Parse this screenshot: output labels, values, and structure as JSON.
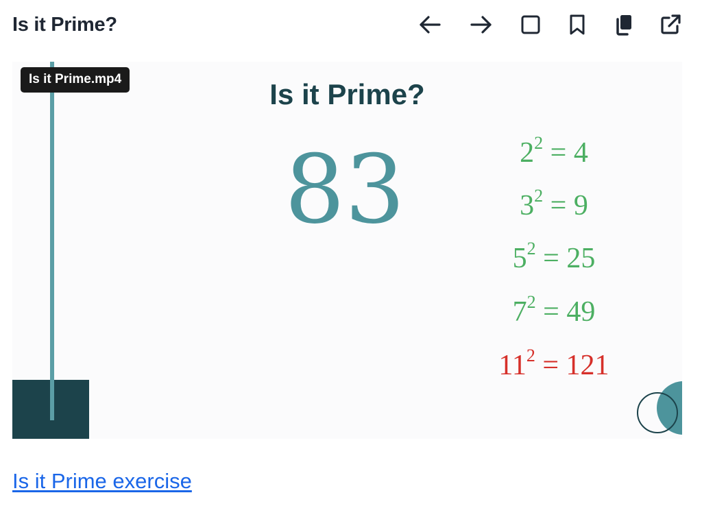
{
  "header": {
    "title": "Is it Prime?",
    "toolbar": [
      {
        "name": "back-arrow-icon"
      },
      {
        "name": "forward-arrow-icon"
      },
      {
        "name": "square-icon"
      },
      {
        "name": "bookmark-icon"
      },
      {
        "name": "copy-icon"
      },
      {
        "name": "external-link-icon"
      }
    ]
  },
  "video": {
    "tooltip": "Is it Prime.mp4",
    "slide_title": "Is it Prime?",
    "number": "83",
    "equations": [
      {
        "base": "2",
        "exp": "2",
        "result": "= 4",
        "color": "#4caf62"
      },
      {
        "base": "3",
        "exp": "2",
        "result": "= 9",
        "color": "#4caf62"
      },
      {
        "base": "5",
        "exp": "2",
        "result": "= 25",
        "color": "#4caf62"
      },
      {
        "base": "7",
        "exp": "2",
        "result": "= 49",
        "color": "#4caf62"
      },
      {
        "base": "11",
        "exp": "2",
        "result": "= 121",
        "color": "#d6302a"
      }
    ]
  },
  "link": {
    "text": "Is it Prime exercise"
  }
}
